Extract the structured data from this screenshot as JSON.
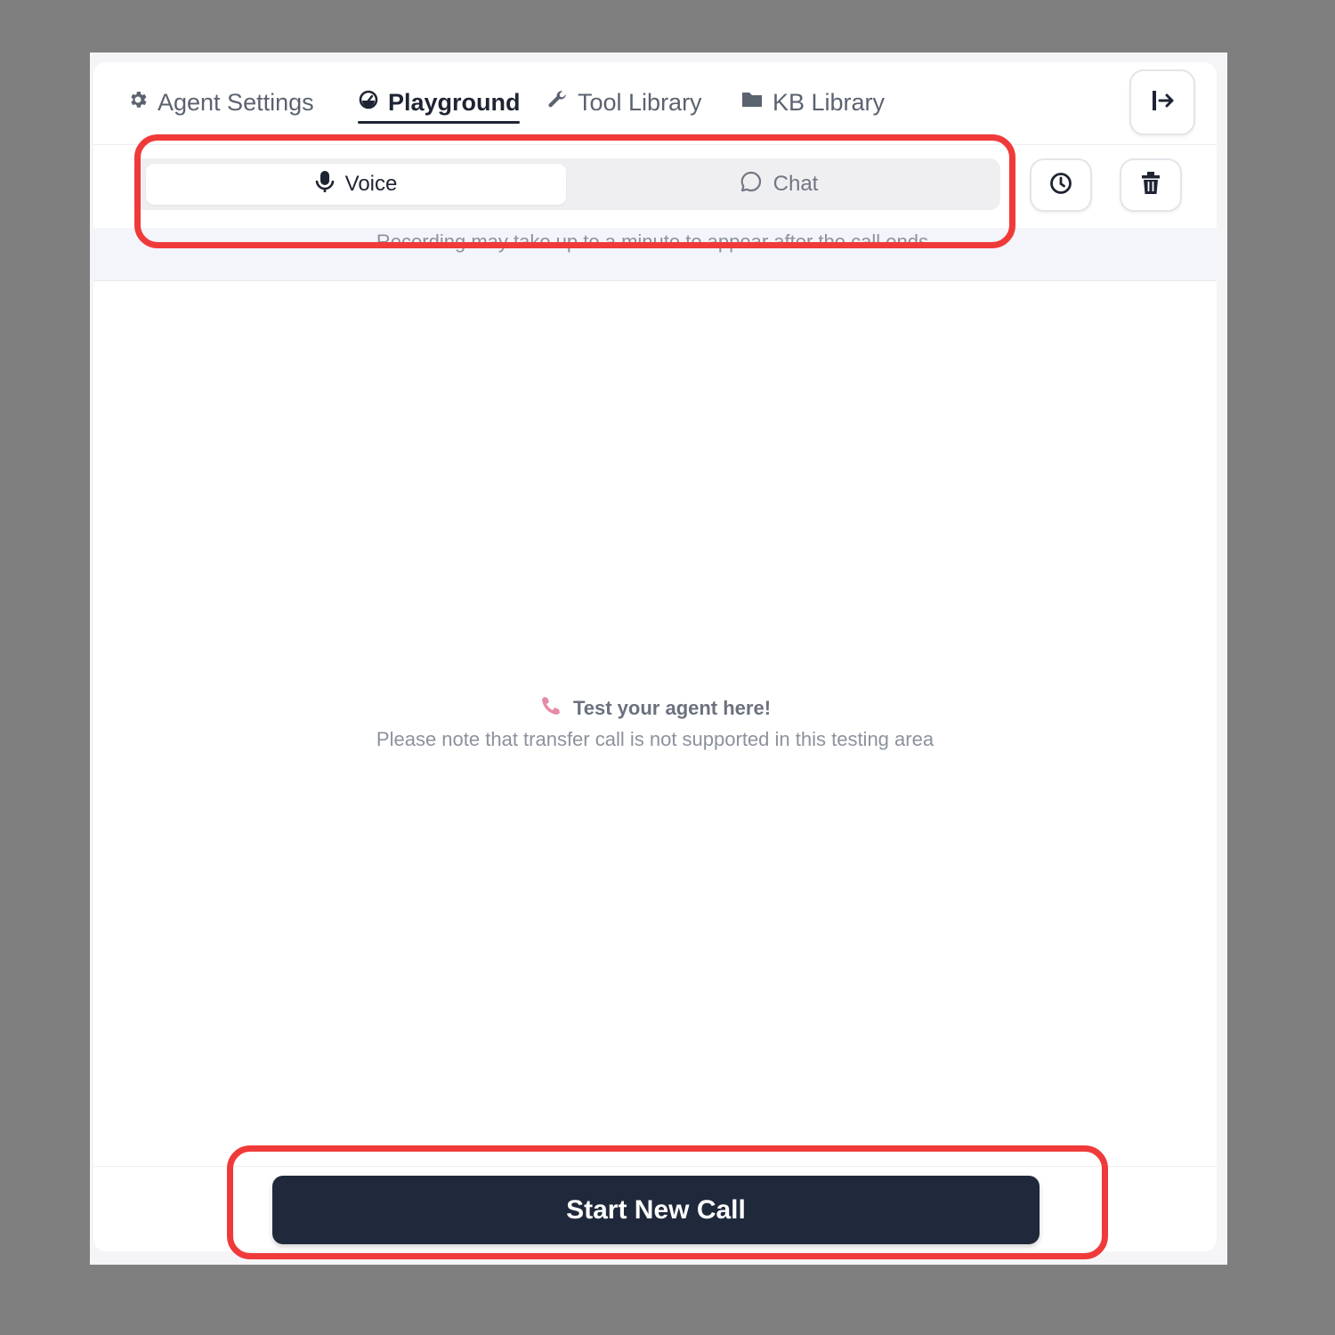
{
  "nav": {
    "tabs": [
      {
        "label": "Agent Settings",
        "icon": "gear-icon"
      },
      {
        "label": "Playground",
        "icon": "gauge-icon",
        "active": true
      },
      {
        "label": "Tool Library",
        "icon": "wrench-icon"
      },
      {
        "label": "KB Library",
        "icon": "folder-icon"
      }
    ],
    "exit_icon": "exit-arrow-icon"
  },
  "mode_toggle": {
    "voice_label": "Voice",
    "voice_icon": "microphone-icon",
    "chat_label": "Chat",
    "chat_icon": "chat-bubble-icon",
    "selected": "Voice"
  },
  "actions": {
    "history_icon": "clock-icon",
    "delete_icon": "trash-icon"
  },
  "notice": "Recording may take up to a minute to appear after the call ends.",
  "empty_state": {
    "icon": "phone-icon",
    "title": "Test your agent here!",
    "subtitle": "Please note that transfer call is not supported in this testing area"
  },
  "start_button": "Start New Call",
  "colors": {
    "background": "#7f7f7f",
    "primary_button": "#1f293b",
    "highlight": "#f03a3a",
    "phone_icon": "#e68aa6"
  }
}
